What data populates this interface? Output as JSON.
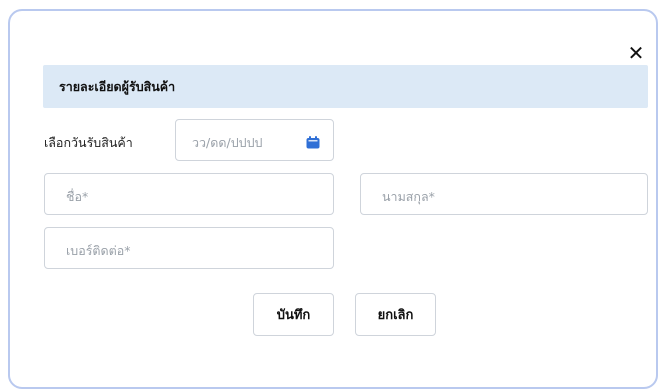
{
  "dialog": {
    "close_icon": "close-icon",
    "close_symbol": "✕"
  },
  "section": {
    "title": "รายละเอียดผู้รับสินค้า"
  },
  "date_picker": {
    "label": "เลือกวันรับสินค้า",
    "placeholder": "วว/ดด/ปปปป",
    "icon": "calendar-icon",
    "icon_color": "#2f6fd6"
  },
  "fields": {
    "first_name_placeholder": "ชื่อ*",
    "last_name_placeholder": "นามสกุล*",
    "phone_placeholder": "เบอร์ติดต่อ*"
  },
  "buttons": {
    "save_label": "บันทึก",
    "cancel_label": "ยกเลิก"
  },
  "colors": {
    "modal_border": "#b9c9ef",
    "header_bg": "#dce9f6"
  }
}
